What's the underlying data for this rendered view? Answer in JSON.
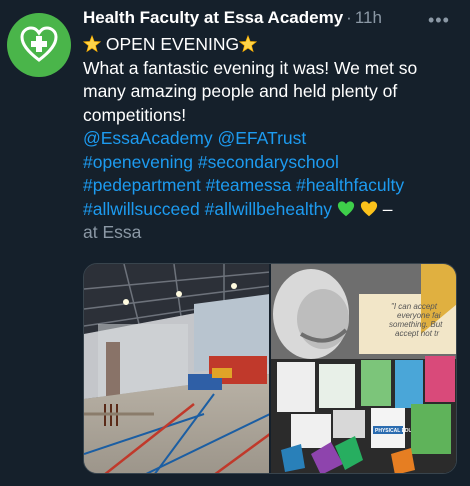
{
  "author": {
    "name": "Health Faculty at Essa Academy",
    "time": "11h"
  },
  "more_label": "•••",
  "tweet": {
    "line1": "OPEN EVENING",
    "line2": "What a fantastic evening it was! We met so",
    "line3": "many amazing people and held plenty of",
    "line4": "competitions!",
    "mentions": [
      "@EssaAcademy",
      "@EFATrust"
    ],
    "hashtags": [
      "#openevening",
      "#secondaryschool",
      "#pedepartment",
      "#teamessa",
      "#healthfaculty",
      "#allwillsucceed",
      "#allwillbehealthy"
    ],
    "dash": "–",
    "location": "at Essa"
  },
  "photo_right": {
    "quote_lines": [
      "\"I can accept",
      "everyone fai",
      "something. But",
      "accept not tr"
    ],
    "book_title": "PHYSICAL EDUCATION"
  },
  "colors": {
    "background": "#15202b",
    "link": "#1d9bf0",
    "muted": "#8b98a5",
    "avatar": "#4ab54a"
  }
}
